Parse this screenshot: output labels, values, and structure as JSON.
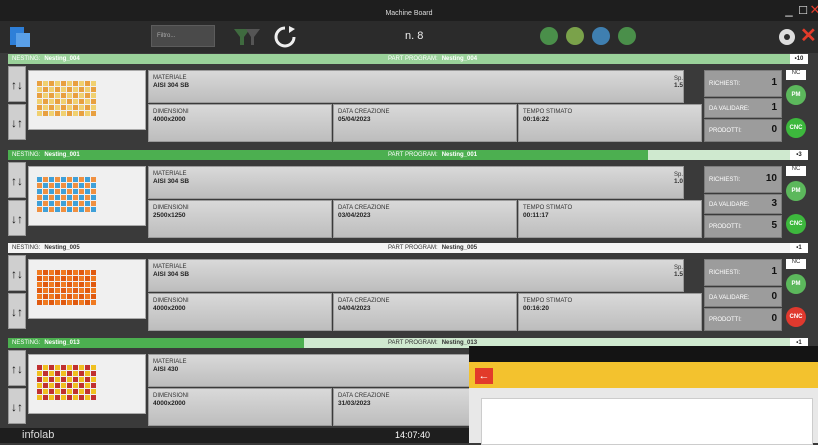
{
  "window": {
    "title": "Machine Board"
  },
  "toolbar": {
    "search_placeholder": "Filtro...",
    "counter": "n. 8"
  },
  "labels": {
    "nesting": "NESTING:",
    "part_program": "PART PROGRAM:",
    "materiale": "MATERIALE",
    "sp": "Sp.",
    "dimensioni": "DIMENSIONI",
    "data_creazione": "DATA CREAZIONE",
    "tempo_stimato": "TEMPO STIMATO",
    "richiesti": "RICHIESTI:",
    "da_validare": "DA VALIDARE:",
    "prodotti": "PRODOTTI:",
    "nc": "NC",
    "pm": "PM",
    "cnc": "CNC"
  },
  "rows": [
    {
      "nesting": "Nesting_004",
      "part_program": "Nesting_004",
      "tag": "•10",
      "progress": 1.0,
      "materiale": "AISI 304 SB",
      "sp": "1.5",
      "dimensioni": "4000x2000",
      "data": "05/04/2023",
      "tempo": "00:16:22",
      "richiesti": "1",
      "da_validare": "1",
      "prodotti": "0",
      "cnc_color": "#3db83d"
    },
    {
      "nesting": "Nesting_001",
      "part_program": "Nesting_001",
      "tag": "•3",
      "progress": 0.8,
      "materiale": "AISI 304 SB",
      "sp": "1.0",
      "dimensioni": "2500x1250",
      "data": "03/04/2023",
      "tempo": "00:11:17",
      "richiesti": "10",
      "da_validare": "3",
      "prodotti": "5",
      "cnc_color": "#3db83d"
    },
    {
      "nesting": "Nesting_005",
      "part_program": "Nesting_005",
      "tag": "•1",
      "progress": 0.0,
      "materiale": "AISI 304 SB",
      "sp": "1.5",
      "dimensioni": "4000x2000",
      "data": "04/04/2023",
      "tempo": "00:16:20",
      "richiesti": "1",
      "da_validare": "0",
      "prodotti": "0",
      "cnc_color": "#e0392e"
    },
    {
      "nesting": "Nesting_013",
      "part_program": "Nesting_013",
      "tag": "•1",
      "progress": 0.37,
      "materiale": "AISI 430",
      "sp": "",
      "dimensioni": "4000x2000",
      "data": "31/03/2023",
      "tempo": "",
      "richiesti": "",
      "da_validare": "",
      "prodotti": "",
      "cnc_color": "#3db83d"
    }
  ],
  "footer": {
    "logo": "infolab",
    "time": "14:07:40"
  },
  "colors": {
    "accent_green": "#5cb85c",
    "progress_green": "#4caf50",
    "bar_light": "#9ad19a",
    "panel_yellow": "#f3c22e",
    "danger": "#e23b2a"
  },
  "icons": [
    "app-logo-icon",
    "filter-icon",
    "refresh-icon",
    "settings-icon",
    "close-icon",
    "back-arrow-icon"
  ]
}
